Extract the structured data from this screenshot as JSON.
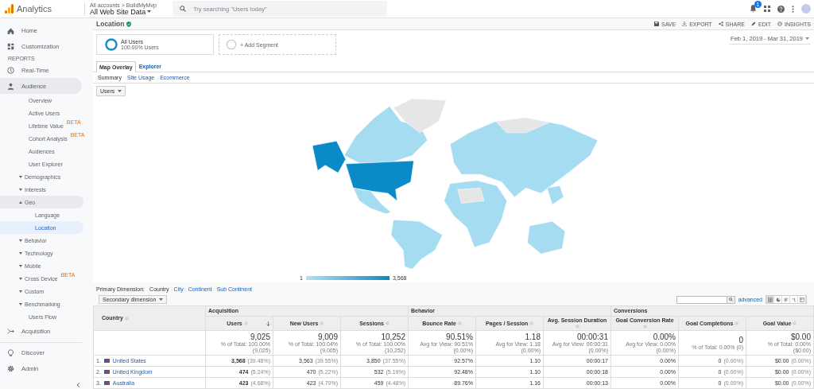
{
  "header": {
    "product": "Analytics",
    "breadcrumb": "All accounts > BuildMyMvp",
    "view": "All Web Site Data",
    "search": {
      "placeholder": "Try searching \"Users today\""
    },
    "notification_count": "1"
  },
  "sidebar": {
    "items": [
      {
        "kind": "item",
        "label": "Home",
        "selected": false
      },
      {
        "kind": "item",
        "label": "Customization",
        "selected": false
      },
      {
        "kind": "heading",
        "label": "REPORTS"
      },
      {
        "kind": "item",
        "label": "Real-Time",
        "selected": false
      },
      {
        "kind": "item",
        "label": "Audience",
        "selected": false,
        "expanded": true,
        "children": [
          {
            "label": "Overview",
            "selected": false
          },
          {
            "label": "Active Users",
            "selected": false
          },
          {
            "label": "Lifetime Value",
            "badge": "BETA",
            "selected": false
          },
          {
            "label": "Cohort Analysis",
            "badge": "BETA",
            "selected": false
          },
          {
            "label": "Audiences",
            "selected": false
          },
          {
            "label": "User Explorer",
            "selected": false
          },
          {
            "label": "Demographics",
            "selected": false,
            "expanded": false
          },
          {
            "label": "Interests",
            "selected": false,
            "expanded": false
          },
          {
            "label": "Geo",
            "selected": false,
            "expanded": true,
            "children": [
              {
                "label": "Language",
                "selected": false
              },
              {
                "label": "Location",
                "selected": true
              }
            ]
          },
          {
            "label": "Behavior",
            "selected": false,
            "expanded": false
          },
          {
            "label": "Technology",
            "selected": false,
            "expanded": false
          },
          {
            "label": "Mobile",
            "selected": false,
            "expanded": false
          },
          {
            "label": "Cross Device",
            "badge": "BETA",
            "selected": false,
            "expanded": false
          },
          {
            "label": "Custom",
            "selected": false,
            "expanded": false
          },
          {
            "label": "Benchmarking",
            "selected": false,
            "expanded": false
          },
          {
            "label": "Users Flow",
            "selected": false
          }
        ]
      },
      {
        "kind": "item",
        "label": "Acquisition",
        "selected": false
      },
      {
        "kind": "item",
        "label": "Discover",
        "selected": false
      },
      {
        "kind": "item",
        "label": "Admin",
        "selected": false
      }
    ]
  },
  "report": {
    "title": "Location",
    "actions": [
      "SAVE",
      "EXPORT",
      "SHARE",
      "EDIT",
      "INSIGHTS"
    ],
    "segments": [
      {
        "kind": "segment",
        "name": "All Users",
        "detail": "100.00% Users"
      },
      {
        "kind": "add",
        "name": "+ Add Segment"
      }
    ],
    "date_range": "Feb 1, 2019 - Mar 31, 2019",
    "tabs": [
      {
        "label": "Map Overlay",
        "selected": true
      },
      {
        "label": "Explorer",
        "selected": false
      }
    ],
    "subtabs": [
      {
        "label": "Summary",
        "selected": true
      },
      {
        "label": "Site Usage",
        "selected": false
      },
      {
        "label": "Ecommerce",
        "selected": false
      }
    ],
    "metric_dropdown": "Users",
    "legend": {
      "min": "1",
      "max": "3,568"
    },
    "primary_dimension": {
      "label": "Primary Dimension:",
      "options": [
        {
          "label": "Country",
          "selected": true
        },
        {
          "label": "City",
          "selected": false
        },
        {
          "label": "Continent",
          "selected": false
        },
        {
          "label": "Sub Continent",
          "selected": false
        }
      ]
    },
    "secondary_dimension": "Secondary dimension",
    "advanced_link": "advanced",
    "view_buttons": [
      {
        "selected": true
      },
      {
        "selected": false
      },
      {
        "selected": false
      },
      {
        "selected": false
      },
      {
        "selected": false
      }
    ],
    "table": {
      "dimension_column": "Country",
      "column_groups": [
        {
          "label": "Acquisition",
          "columns": [
            {
              "label": "Users",
              "sorted": true
            },
            {
              "label": "New Users",
              "sorted": false
            },
            {
              "label": "Sessions",
              "sorted": false
            }
          ]
        },
        {
          "label": "Behavior",
          "columns": [
            {
              "label": "Bounce Rate",
              "sorted": false
            },
            {
              "label": "Pages / Session",
              "sorted": false
            },
            {
              "label": "Avg. Session Duration",
              "sorted": false
            }
          ]
        },
        {
          "label": "Conversions",
          "columns": [
            {
              "label": "Goal Conversion Rate",
              "sorted": false
            },
            {
              "label": "Goal Completions",
              "sorted": false
            },
            {
              "label": "Goal Value",
              "sorted": false
            }
          ]
        }
      ],
      "totals": [
        {
          "value": "9,025",
          "note": "% of Total: 100.00% (9,025)"
        },
        {
          "value": "9,009",
          "note": "% of Total: 100.04% (9,005)"
        },
        {
          "value": "10,252",
          "note": "% of Total: 100.00% (10,252)"
        },
        {
          "value": "90.51%",
          "note": "Avg for View: 90.51% (0.00%)"
        },
        {
          "value": "1.18",
          "note": "Avg for View: 1.18 (0.00%)"
        },
        {
          "value": "00:00:31",
          "note": "Avg for View: 00:00:31 (0.00%)"
        },
        {
          "value": "0.00%",
          "note": "Avg for View: 0.00% (0.00%)"
        },
        {
          "value": "0",
          "note": "% of Total: 0.00% (0)"
        },
        {
          "value": "$0.00",
          "note": "% of Total: 0.00% ($0.00)"
        }
      ],
      "rows": [
        {
          "index": "1.",
          "country": "United States",
          "cells": [
            {
              "value": "3,568",
              "share": "(39.48%)",
              "bold": true
            },
            {
              "value": "3,563",
              "share": "(39.55%)"
            },
            {
              "value": "3,850",
              "share": "(37.55%)"
            },
            {
              "value": "92.57%"
            },
            {
              "value": "1.10"
            },
            {
              "value": "00:00:17"
            },
            {
              "value": "0.00%"
            },
            {
              "value": "0",
              "share": "(0.00%)"
            },
            {
              "value": "$0.00",
              "share": "(0.00%)"
            }
          ]
        },
        {
          "index": "2.",
          "country": "United Kingdom",
          "cells": [
            {
              "value": "474",
              "share": "(5.24%)",
              "bold": true
            },
            {
              "value": "470",
              "share": "(5.22%)"
            },
            {
              "value": "532",
              "share": "(5.19%)"
            },
            {
              "value": "92.48%"
            },
            {
              "value": "1.10"
            },
            {
              "value": "00:00:18"
            },
            {
              "value": "0.00%"
            },
            {
              "value": "0",
              "share": "(0.00%)"
            },
            {
              "value": "$0.00",
              "share": "(0.00%)"
            }
          ]
        },
        {
          "index": "3.",
          "country": "Australia",
          "cells": [
            {
              "value": "423",
              "share": "(4.68%)",
              "bold": true
            },
            {
              "value": "423",
              "share": "(4.70%)"
            },
            {
              "value": "459",
              "share": "(4.48%)"
            },
            {
              "value": "89.76%"
            },
            {
              "value": "1.16"
            },
            {
              "value": "00:00:13"
            },
            {
              "value": "0.00%"
            },
            {
              "value": "0",
              "share": "(0.00%)"
            },
            {
              "value": "$0.00",
              "share": "(0.00%)"
            }
          ]
        }
      ]
    }
  }
}
